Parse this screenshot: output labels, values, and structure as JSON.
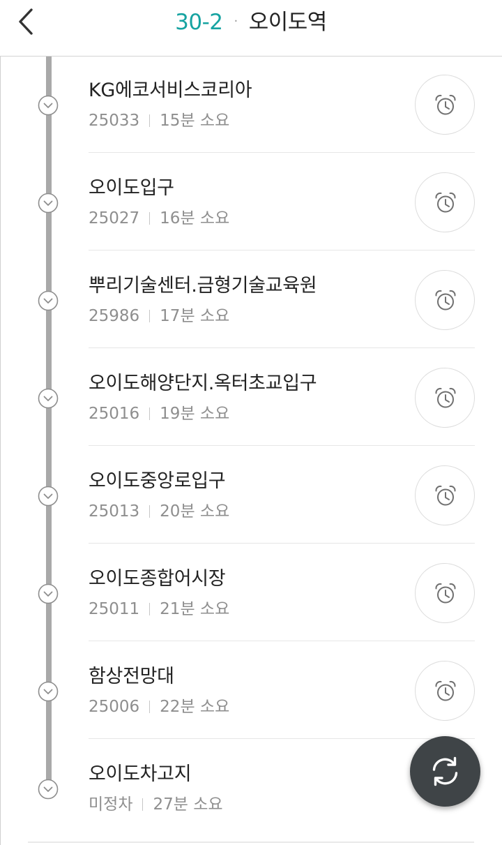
{
  "header": {
    "back_icon": "chevron-left-icon",
    "route_number": "30-2",
    "separator": "·",
    "destination": "오이도역",
    "accent_color": "#16a3a1"
  },
  "stops": [
    {
      "name": "KG에코서비스코리아",
      "stop_id": "25033",
      "duration": "15분 소요",
      "alarm_icon": "alarm-clock-icon"
    },
    {
      "name": "오이도입구",
      "stop_id": "25027",
      "duration": "16분 소요",
      "alarm_icon": "alarm-clock-icon"
    },
    {
      "name": "뿌리기술센터.금형기술교육원",
      "stop_id": "25986",
      "duration": "17분 소요",
      "alarm_icon": "alarm-clock-icon"
    },
    {
      "name": "오이도해양단지.옥터초교입구",
      "stop_id": "25016",
      "duration": "19분 소요",
      "alarm_icon": "alarm-clock-icon"
    },
    {
      "name": "오이도중앙로입구",
      "stop_id": "25013",
      "duration": "20분 소요",
      "alarm_icon": "alarm-clock-icon"
    },
    {
      "name": "오이도종합어시장",
      "stop_id": "25011",
      "duration": "21분 소요",
      "alarm_icon": "alarm-clock-icon"
    },
    {
      "name": "함상전망대",
      "stop_id": "25006",
      "duration": "22분 소요",
      "alarm_icon": "alarm-clock-icon"
    },
    {
      "name": "오이도차고지",
      "stop_id": "미정차",
      "duration": "27분 소요"
    }
  ],
  "refresh_button": {
    "icon": "refresh-icon",
    "color": "#3f4447"
  }
}
